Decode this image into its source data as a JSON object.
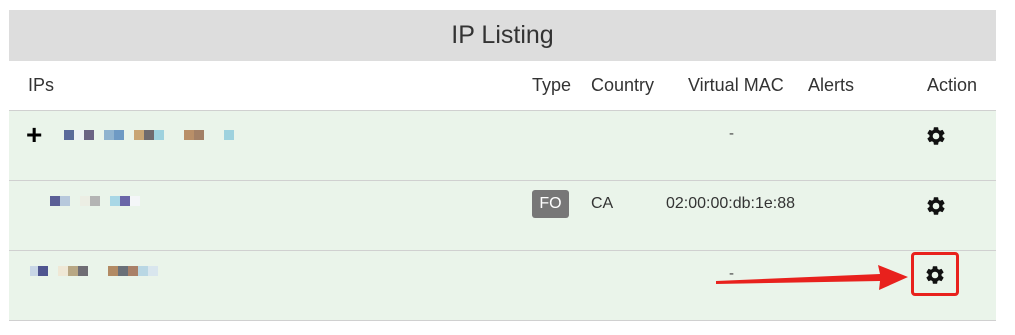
{
  "title": "IP Listing",
  "columns": {
    "ips": "IPs",
    "type": "Type",
    "country": "Country",
    "virtual_mac": "Virtual MAC",
    "alerts": "Alerts",
    "action": "Action"
  },
  "rows": [
    {
      "type": "",
      "country": "",
      "virtual_mac": "-",
      "alerts": ""
    },
    {
      "type": "FO",
      "country": "CA",
      "virtual_mac": "02:00:00:db:1e:88",
      "alerts": ""
    },
    {
      "type": "",
      "country": "",
      "virtual_mac": "-",
      "alerts": ""
    }
  ],
  "icons": {
    "expand": "plus-icon",
    "action": "gear-icon"
  },
  "colors": {
    "header_bg": "#dddddd",
    "row_bg": "#eaf4ea",
    "badge_bg": "#777777",
    "highlight": "#e8211d"
  }
}
